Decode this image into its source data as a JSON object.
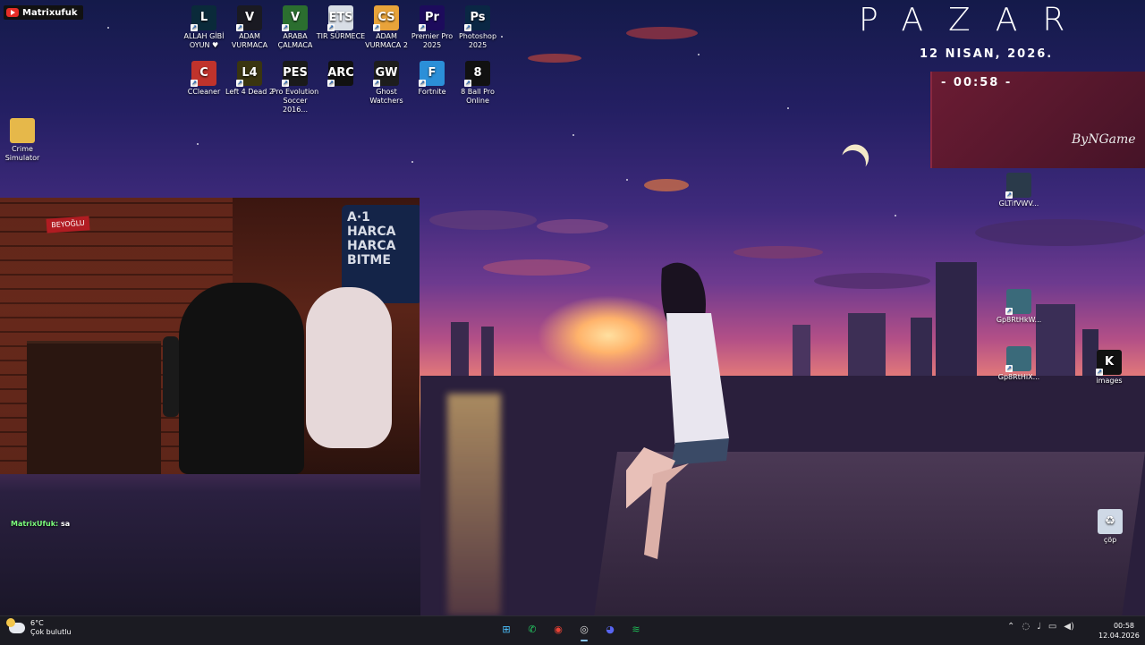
{
  "channel_badge": {
    "name": "Matrixufuk"
  },
  "clock_widget": {
    "day": "PAZAR",
    "date": "12 NISAN, 2026.",
    "time": "- 00:58 -",
    "signature": "ByNGame"
  },
  "desktop_icons_top": [
    {
      "label": "ALLAH GİBİ OYUN ♥",
      "icon": "league-of-legends-icon",
      "color": "#0a2a3a",
      "glyph": "L"
    },
    {
      "label": "ADAM VURMACA",
      "icon": "valorant-icon",
      "color": "#1a1a22",
      "glyph": "V"
    },
    {
      "label": "ARABA ÇALMACA",
      "icon": "gta-v-icon",
      "color": "#2b6e2f",
      "glyph": "V"
    },
    {
      "label": "TIR SÜRMECE",
      "icon": "euro-truck-icon",
      "color": "#d8dee6",
      "glyph": "ETS"
    },
    {
      "label": "ADAM VURMACA 2",
      "icon": "counter-strike-icon",
      "color": "#e8a33a",
      "glyph": "CS"
    },
    {
      "label": "Premier Pro 2025",
      "icon": "premiere-pro-icon",
      "color": "#1d0b5c",
      "glyph": "Pr"
    },
    {
      "label": "Photoshop 2025",
      "icon": "photoshop-icon",
      "color": "#0a2744",
      "glyph": "Ps"
    }
  ],
  "desktop_icons_second": [
    {
      "label": "CCleaner",
      "icon": "ccleaner-icon",
      "color": "#c0332c",
      "glyph": "C"
    },
    {
      "label": "Left 4 Dead 2",
      "icon": "left4dead-icon",
      "color": "#3a3510",
      "glyph": "L4"
    },
    {
      "label": "Pro Evolution Soccer 2016...",
      "icon": "pes-icon",
      "color": "#1a1a1a",
      "glyph": "PES"
    },
    {
      "label": "",
      "icon": "arc-raiders-icon",
      "color": "#111111",
      "glyph": "ARC"
    },
    {
      "label": "Ghost Watchers",
      "icon": "ghost-watchers-icon",
      "color": "#1d1d1d",
      "glyph": "GW"
    },
    {
      "label": "Fortnite",
      "icon": "fortnite-icon",
      "color": "#2b8fd8",
      "glyph": "F"
    },
    {
      "label": "8 Ball Pro Online",
      "icon": "8-ball-icon",
      "color": "#111111",
      "glyph": "8"
    }
  ],
  "desktop_icons_left": [
    {
      "label": "Crime Simulator",
      "icon": "folder-icon",
      "color": "#e6b84a",
      "glyph": ""
    }
  ],
  "desktop_icons_right": [
    {
      "label": "GLTifVWV...",
      "icon": "photo-portrait-icon",
      "color": "#2a3a4a",
      "glyph": ""
    },
    {
      "label": "Gp8RtHkW...",
      "icon": "photo-thumb-icon",
      "color": "#3a6a7a",
      "glyph": ""
    },
    {
      "label": "Gp8RtHiX...",
      "icon": "photo-thumb-icon",
      "color": "#3a6a7a",
      "glyph": ""
    },
    {
      "label": "images",
      "icon": "kick-icon",
      "color": "#111111",
      "glyph": "K"
    },
    {
      "label": "çöp",
      "icon": "recycle-bin-icon",
      "color": "#cfd9e6",
      "glyph": "♻"
    }
  ],
  "webcam": {
    "neon_sign": "BEYOĞLU",
    "poster_text": "A·1 HARCA HARCA BITME"
  },
  "chat": {
    "user": "MatrixUfuk:",
    "message": "sa"
  },
  "taskbar": {
    "weather_temp": "6°C",
    "weather_desc": "Çok bulutlu",
    "apps": [
      {
        "name": "start-button",
        "glyph": "⊞",
        "color": "#4cc2ff",
        "active": false
      },
      {
        "name": "whatsapp-button",
        "glyph": "✆",
        "color": "#25d366",
        "active": false
      },
      {
        "name": "chrome-button",
        "glyph": "◉",
        "color": "#e94235",
        "active": false
      },
      {
        "name": "obs-button",
        "glyph": "◎",
        "color": "#dddddd",
        "active": true
      },
      {
        "name": "discord-button",
        "glyph": "◕",
        "color": "#5865f2",
        "active": false
      },
      {
        "name": "spotify-button",
        "glyph": "≋",
        "color": "#1db954",
        "active": false
      }
    ],
    "time": "00:58",
    "date": "12.04.2026"
  }
}
